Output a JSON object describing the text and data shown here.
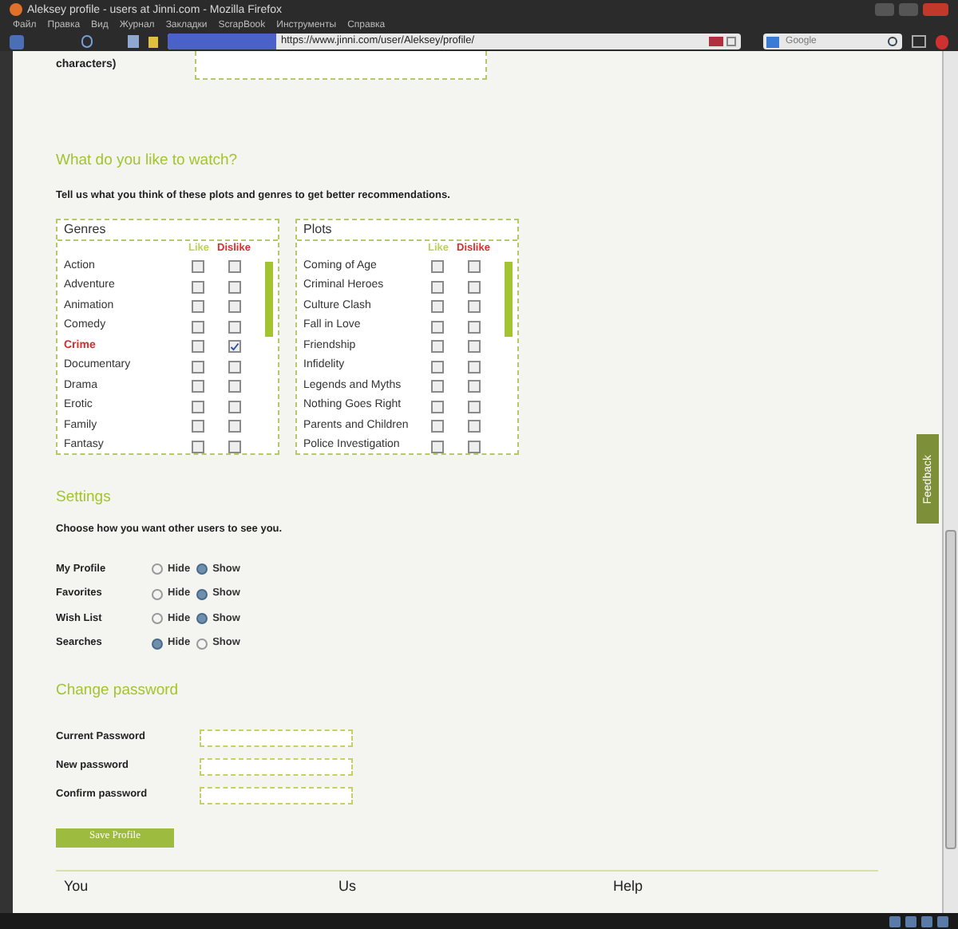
{
  "window": {
    "title": "Aleksey profile - users at Jinni.com - Mozilla Firefox"
  },
  "menu": [
    "Файл",
    "Правка",
    "Вид",
    "Журнал",
    "Закладки",
    "ScrapBook",
    "Инструменты",
    "Справка"
  ],
  "address_bar": {
    "url": "https://www.jinni.com/user/Aleksey/profile/"
  },
  "search_box": {
    "placeholder": "Google"
  },
  "page": {
    "overflow_text": "characters)",
    "watch": {
      "heading": "What do you like to watch?",
      "description": "Tell us what you think of these plots and genres to get better recommendations.",
      "lists": [
        {
          "title": "Genres",
          "like_label": "Like",
          "dislike_label": "Dislike",
          "items": [
            {
              "label": "Action",
              "like": false,
              "dislike": false,
              "highlighted": false
            },
            {
              "label": "Adventure",
              "like": false,
              "dislike": false,
              "highlighted": false
            },
            {
              "label": "Animation",
              "like": false,
              "dislike": false,
              "highlighted": false
            },
            {
              "label": "Comedy",
              "like": false,
              "dislike": false,
              "highlighted": false
            },
            {
              "label": "Crime",
              "like": false,
              "dislike": true,
              "highlighted": true
            },
            {
              "label": "Documentary",
              "like": false,
              "dislike": false,
              "highlighted": false
            },
            {
              "label": "Drama",
              "like": false,
              "dislike": false,
              "highlighted": false
            },
            {
              "label": "Erotic",
              "like": false,
              "dislike": false,
              "highlighted": false
            },
            {
              "label": "Family",
              "like": false,
              "dislike": false,
              "highlighted": false
            },
            {
              "label": "Fantasy",
              "like": false,
              "dislike": false,
              "highlighted": false
            }
          ]
        },
        {
          "title": "Plots",
          "like_label": "Like",
          "dislike_label": "Dislike",
          "items": [
            {
              "label": "Coming of Age",
              "like": false,
              "dislike": false,
              "highlighted": false
            },
            {
              "label": "Criminal Heroes",
              "like": false,
              "dislike": false,
              "highlighted": false
            },
            {
              "label": "Culture Clash",
              "like": false,
              "dislike": false,
              "highlighted": false
            },
            {
              "label": "Fall in Love",
              "like": false,
              "dislike": false,
              "highlighted": false
            },
            {
              "label": "Friendship",
              "like": false,
              "dislike": false,
              "highlighted": false
            },
            {
              "label": "Infidelity",
              "like": false,
              "dislike": false,
              "highlighted": false
            },
            {
              "label": "Legends and Myths",
              "like": false,
              "dislike": false,
              "highlighted": false
            },
            {
              "label": "Nothing Goes Right",
              "like": false,
              "dislike": false,
              "highlighted": false
            },
            {
              "label": "Parents and Children",
              "like": false,
              "dislike": false,
              "highlighted": false
            },
            {
              "label": "Police Investigation",
              "like": false,
              "dislike": false,
              "highlighted": false
            }
          ]
        }
      ]
    },
    "settings": {
      "heading": "Settings",
      "description": "Choose how you want other users to see you.",
      "rows": [
        {
          "label": "My Profile",
          "options": [
            {
              "label": "Hide",
              "selected": false
            },
            {
              "label": "Show",
              "selected": true
            }
          ]
        },
        {
          "label": "Favorites",
          "options": [
            {
              "label": "Hide",
              "selected": false
            },
            {
              "label": "Show",
              "selected": true
            }
          ]
        },
        {
          "label": "Wish List",
          "options": [
            {
              "label": "Hide",
              "selected": false
            },
            {
              "label": "Show",
              "selected": true
            }
          ]
        },
        {
          "label": "Searches",
          "options": [
            {
              "label": "Hide",
              "selected": true
            },
            {
              "label": "Show",
              "selected": false
            }
          ]
        }
      ]
    },
    "password": {
      "heading": "Change password",
      "fields": [
        {
          "label": "Current Password"
        },
        {
          "label": "New password"
        },
        {
          "label": "Confirm password"
        }
      ]
    },
    "save_button": "Save Profile",
    "footer_links": [
      "You",
      "Us",
      "Help"
    ],
    "feedback_tab": "Feedback"
  }
}
